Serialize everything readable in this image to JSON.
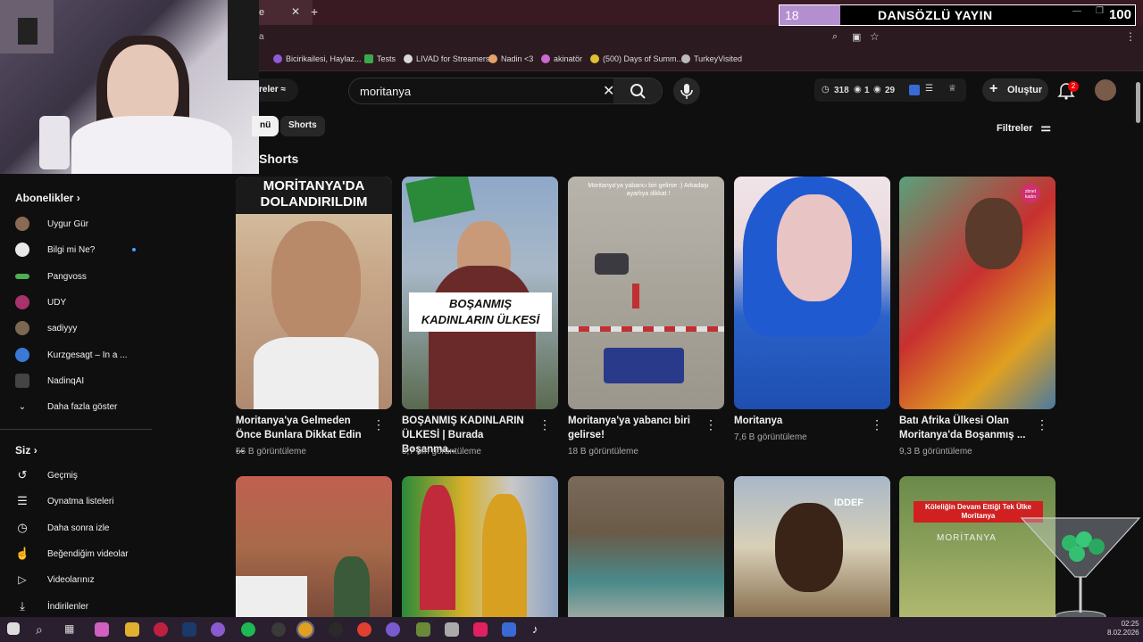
{
  "browser": {
    "tab_active_label": "e",
    "address_prefix": "a",
    "bookmarks": [
      {
        "label": "Bicirikailesi, Haylaz...",
        "color": "#8e5bd6"
      },
      {
        "label": "Tests",
        "color": "#3ca84a"
      },
      {
        "label": "LIVAD for Streamers",
        "color": "#d9d9d9"
      },
      {
        "label": "Nadin <3",
        "color": "#e2a36a"
      },
      {
        "label": "akinatör",
        "color": "#c86ad0"
      },
      {
        "label": "(500) Days of Summ...",
        "color": "#e0c030"
      },
      {
        "label": "TurkeyVisited",
        "color": "#bbbbbb"
      }
    ]
  },
  "overlay": {
    "count": "18",
    "title": "DANSÖZLÜ YAYIN",
    "number": "100",
    "accent": "#b48fd0"
  },
  "youtube": {
    "filter_label": "reler",
    "search": {
      "query": "moritanya"
    },
    "stats": {
      "clock": "318",
      "eye1": "1",
      "eye2": "29"
    },
    "create_label": "Oluştur",
    "notifications": "2",
    "chips": [
      "nü",
      "Shorts"
    ],
    "filters_label": "Filtreler",
    "shorts_heading": "Shorts"
  },
  "sidebar": {
    "subs_heading": "Abonelikler",
    "subs": [
      {
        "label": "Uygur Gür",
        "color": "#8a6a52"
      },
      {
        "label": "Bilgi mi Ne?",
        "color": "#e8e8e8",
        "new": true
      },
      {
        "label": "Pangvoss",
        "color": "#4caf50"
      },
      {
        "label": "UDY",
        "color": "#a8326a"
      },
      {
        "label": "sadiyyy",
        "color": "#7a6850"
      },
      {
        "label": "Kurzgesagt – In a ...",
        "color": "#3a7ad6"
      },
      {
        "label": "NadinqAI",
        "color": "#444"
      }
    ],
    "more_label": "Daha fazla göster",
    "you_heading": "Siz",
    "you_items": [
      {
        "label": "Geçmiş",
        "icon": "history-icon"
      },
      {
        "label": "Oynatma listeleri",
        "icon": "playlist-icon"
      },
      {
        "label": "Daha sonra izle",
        "icon": "clock-icon"
      },
      {
        "label": "Beğendiğim videolar",
        "icon": "thumbs-up-icon"
      },
      {
        "label": "Videolarınız",
        "icon": "video-icon"
      },
      {
        "label": "İndirilenler",
        "icon": "download-icon"
      }
    ]
  },
  "shorts": [
    {
      "title": "Moritanya'ya Gelmeden Önce Bunlara Dikkat Edin ...",
      "views": "56 B görüntüleme",
      "overlay": "MORİTANYA'DA DOLANDIRILDIM"
    },
    {
      "title": "BOŞANMIŞ KADINLARIN ÜLKESİ | Burada Boşanma...",
      "views": "3,7 Mn görüntüleme",
      "overlay": "BOŞANMIŞ KADINLARIN ÜLKESİ"
    },
    {
      "title": "Moritanya'ya yabancı biri gelirse!",
      "views": "18 B görüntüleme",
      "overlay": "Moritanya'ya yabancı biri gelirse :) Arkadaşı ayarlıya dikkat !"
    },
    {
      "title": "Moritanya",
      "views": "7,6 B görüntüleme",
      "overlay": ""
    },
    {
      "title": "Batı Afrika Ülkesi Olan Moritanya'da Boşanmış ...",
      "views": "9,3 B görüntüleme",
      "overlay": "zbnet kadın"
    }
  ],
  "row2": [
    {
      "overlay": ""
    },
    {
      "overlay": ""
    },
    {
      "overlay": ""
    },
    {
      "overlay": "IDDEF"
    },
    {
      "overlay": "Köleliğin Devam Ettiği Tek Ülke Moritanya",
      "sub": "MORİTANYA"
    }
  ],
  "taskbar": {
    "time": "02:25",
    "date": "8.02.2026"
  }
}
